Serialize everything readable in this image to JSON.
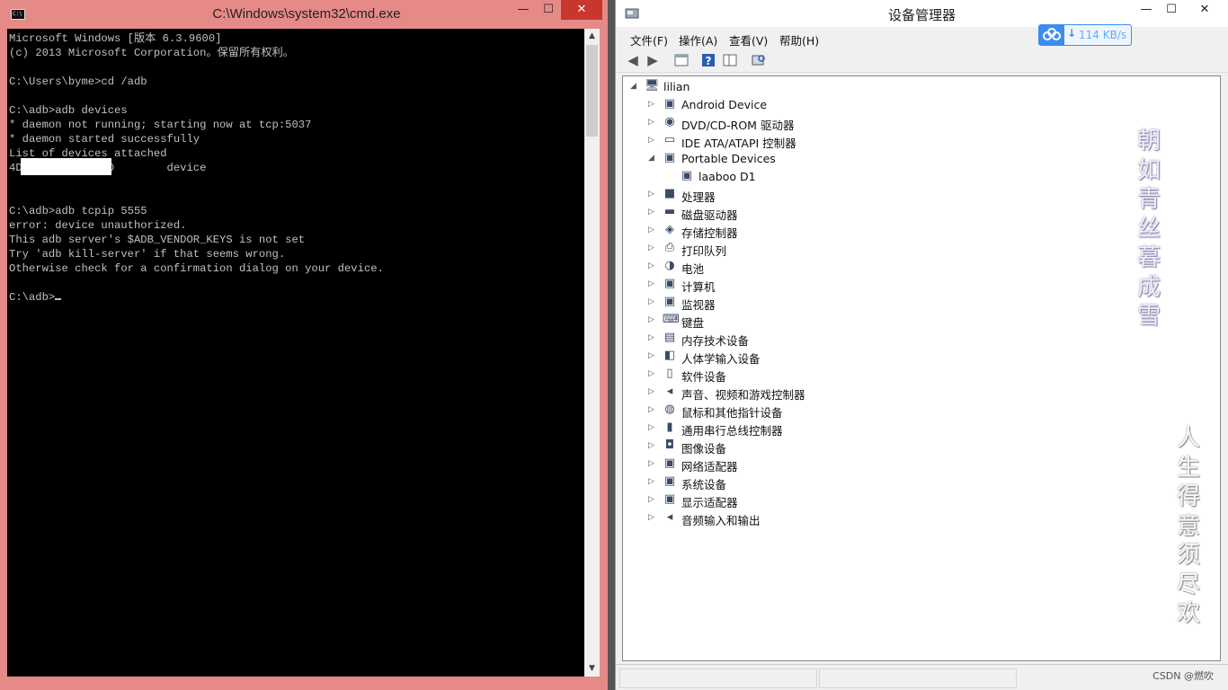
{
  "cmd": {
    "title": "C:\\Windows\\system32\\cmd.exe",
    "lines": [
      "Microsoft Windows [版本 6.3.9600]",
      "(c) 2013 Microsoft Corporation。保留所有权利。",
      "",
      "C:\\Users\\byme>cd /adb",
      "",
      "C:\\adb>adb devices",
      "* daemon not running; starting now at tcp:5037",
      "* daemon started successfully",
      "List of devices attached",
      "4D            5D        device",
      "",
      "",
      "C:\\adb>adb tcpip 5555",
      "error: device unauthorized.",
      "This adb server's $ADB_VENDOR_KEYS is not set",
      "Try 'adb kill-server' if that seems wrong.",
      "Otherwise check for a confirmation dialog on your device.",
      "",
      "C:\\adb>"
    ],
    "buttons": {
      "minimize": "—",
      "maximize": "☐",
      "close": "✕"
    },
    "scroll_up": "▲",
    "scroll_down": "▼"
  },
  "device_manager": {
    "title": "设备管理器",
    "buttons": {
      "minimize": "—",
      "maximize": "☐",
      "close": "✕"
    },
    "menu": [
      "文件(F)",
      "操作(A)",
      "查看(V)",
      "帮助(H)"
    ],
    "net_speed": "114 KB/s",
    "root": "lilian",
    "tree_items": [
      {
        "label": "Android Device",
        "expanded": false,
        "icon": "android-device-icon"
      },
      {
        "label": "DVD/CD-ROM 驱动器",
        "expanded": false,
        "icon": "dvd-drive-icon"
      },
      {
        "label": "IDE ATA/ATAPI 控制器",
        "expanded": false,
        "icon": "ide-controller-icon"
      },
      {
        "label": "Portable Devices",
        "expanded": true,
        "icon": "portable-devices-icon"
      },
      {
        "label": "laaboo D1",
        "child": true,
        "icon": "portable-device-icon"
      },
      {
        "label": "处理器",
        "expanded": false,
        "icon": "processor-icon"
      },
      {
        "label": "磁盘驱动器",
        "expanded": false,
        "icon": "disk-drive-icon"
      },
      {
        "label": "存储控制器",
        "expanded": false,
        "icon": "storage-controller-icon"
      },
      {
        "label": "打印队列",
        "expanded": false,
        "icon": "printer-icon"
      },
      {
        "label": "电池",
        "expanded": false,
        "icon": "battery-icon"
      },
      {
        "label": "计算机",
        "expanded": false,
        "icon": "computer-icon"
      },
      {
        "label": "监视器",
        "expanded": false,
        "icon": "monitor-icon"
      },
      {
        "label": "键盘",
        "expanded": false,
        "icon": "keyboard-icon"
      },
      {
        "label": "内存技术设备",
        "expanded": false,
        "icon": "memory-device-icon"
      },
      {
        "label": "人体学输入设备",
        "expanded": false,
        "icon": "hid-icon"
      },
      {
        "label": "软件设备",
        "expanded": false,
        "icon": "software-device-icon"
      },
      {
        "label": "声音、视频和游戏控制器",
        "expanded": false,
        "icon": "sound-icon"
      },
      {
        "label": "鼠标和其他指针设备",
        "expanded": false,
        "icon": "mouse-icon"
      },
      {
        "label": "通用串行总线控制器",
        "expanded": false,
        "icon": "usb-icon"
      },
      {
        "label": "图像设备",
        "expanded": false,
        "icon": "camera-icon"
      },
      {
        "label": "网络适配器",
        "expanded": false,
        "icon": "network-adapter-icon"
      },
      {
        "label": "系统设备",
        "expanded": false,
        "icon": "system-device-icon"
      },
      {
        "label": "显示适配器",
        "expanded": false,
        "icon": "display-adapter-icon"
      },
      {
        "label": "音频输入和输出",
        "expanded": false,
        "icon": "audio-io-icon"
      }
    ]
  },
  "overlay": {
    "poem_line1": [
      "朝",
      "如",
      "青",
      "丝",
      "暮",
      "成",
      "雪"
    ],
    "poem_line2": [
      "人",
      "生",
      "得",
      "意",
      "须",
      "尽",
      "欢"
    ],
    "watermark": "CSDN @燃吹"
  }
}
